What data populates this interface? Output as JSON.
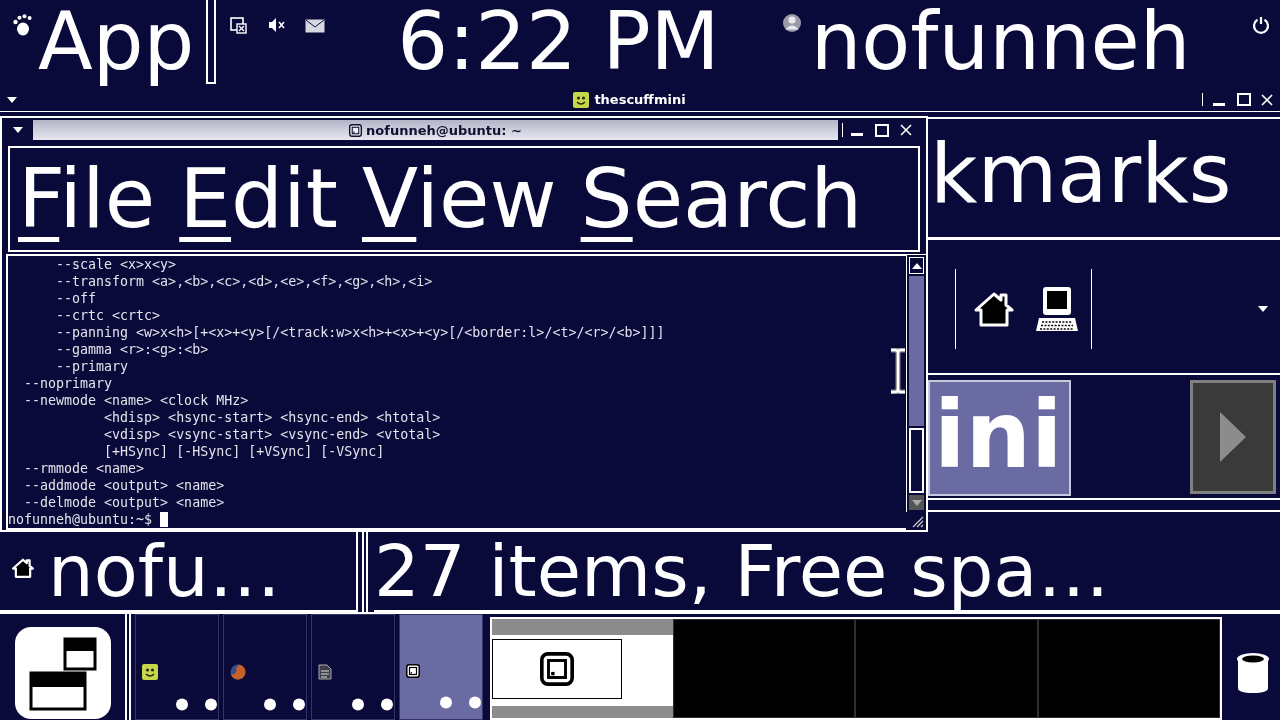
{
  "top_panel": {
    "menu": "App",
    "volume": {
      "muted": true
    },
    "clock": "6:22 PM",
    "user": "nofunneh"
  },
  "file_manager": {
    "title": "thescuffmini",
    "menu": [
      {
        "text": "kmarks"
      }
    ],
    "path_buttons": [
      {
        "label": "ini",
        "selected": true
      }
    ],
    "status_bar": {
      "location": "nofu…",
      "info": "27 items, Free spa…"
    }
  },
  "terminal": {
    "title": "nofunneh@ubuntu: ~",
    "menu": [
      {
        "mnemonic": "F",
        "text": "ile"
      },
      {
        "mnemonic": "E",
        "text": "dit"
      },
      {
        "mnemonic": "V",
        "text": "iew"
      },
      {
        "mnemonic": "S",
        "text": "earch"
      }
    ],
    "lines": [
      "      --scale <x>x<y>",
      "      --transform <a>,<b>,<c>,<d>,<e>,<f>,<g>,<h>,<i>",
      "      --off",
      "      --crtc <crtc>",
      "      --panning <w>x<h>[+<x>+<y>[/<track:w>x<h>+<x>+<y>[/<border:l>/<t>/<r>/<b>]]]",
      "      --gamma <r>:<g>:<b>",
      "      --primary",
      "  --noprimary",
      "  --newmode <name> <clock MHz>",
      "            <hdisp> <hsync-start> <hsync-end> <htotal>",
      "            <vdisp> <vsync-start> <vsync-end> <vtotal>",
      "            [+HSync] [-HSync] [+VSync] [-VSync]",
      "  --rmmode <name>",
      "  --addmode <output> <name>",
      "  --delmode <output> <name>"
    ],
    "prompt": "nofunneh@ubuntu:~$"
  },
  "bottom_panel": {
    "windows": [
      {
        "kind": "files",
        "selected": false
      },
      {
        "kind": "browser",
        "selected": false
      },
      {
        "kind": "editor",
        "selected": false
      },
      {
        "kind": "terminal",
        "selected": true
      }
    ],
    "workspaces": [
      {
        "selected": true
      },
      {
        "selected": false
      },
      {
        "selected": false
      },
      {
        "selected": false
      }
    ]
  }
}
